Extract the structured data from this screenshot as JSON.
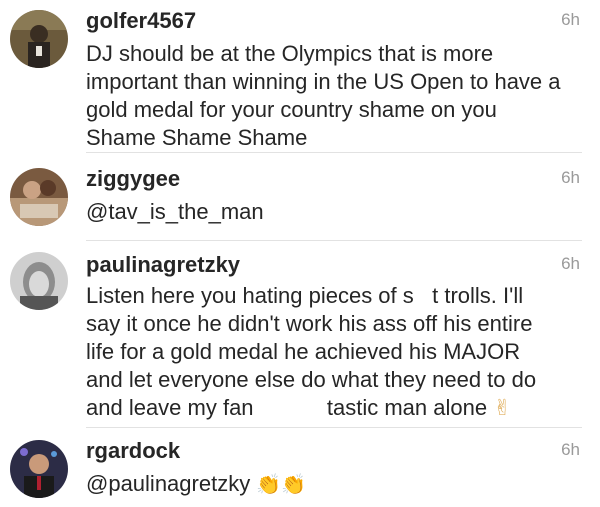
{
  "comments": [
    {
      "username": "golfer4567",
      "time": "6h",
      "text": "DJ should be at the Olympics that is more important than winning in the US Open to have a gold medal for your country shame on you Shame Shame Shame"
    },
    {
      "username": "ziggygee",
      "time": "6h",
      "text": "@tav_is_the_man"
    },
    {
      "username": "paulinagretzky",
      "time": "6h",
      "text_lines": [
        "Listen here you hating pieces of s   t trolls. I'll",
        "say it once he didn't work his ass off his entire",
        "life for a gold medal he achieved his MAJOR",
        "and let everyone else do what they need to do",
        "and leave my fan            tastic man alone"
      ],
      "emoji": "✌"
    },
    {
      "username": "rgardock",
      "time": "6h",
      "text": "@paulinagretzky",
      "emoji": "👏👏"
    }
  ]
}
